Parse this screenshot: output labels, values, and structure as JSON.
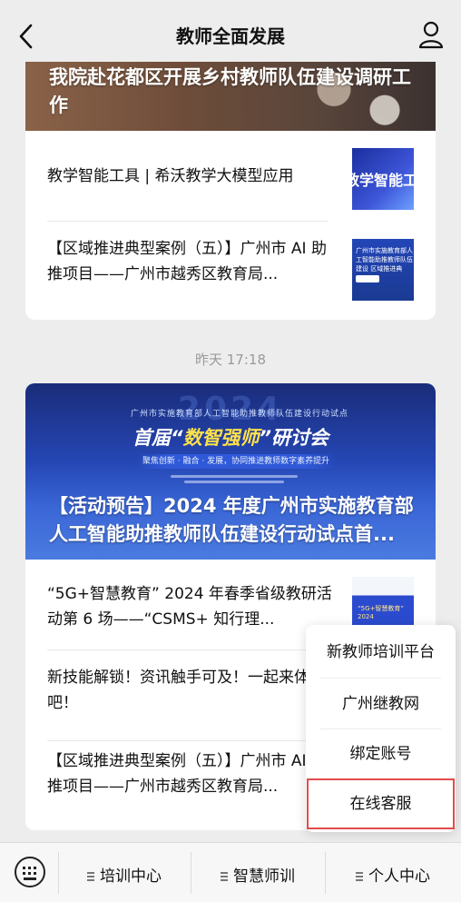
{
  "header": {
    "title": "教师全面发展",
    "back_icon": "chevron-left-icon",
    "profile_icon": "user-icon"
  },
  "card1": {
    "banner_title": "我院赴花都区开展乡村教师队伍建设调研工作",
    "items": [
      {
        "title": "教学智能工具 | 希沃教学大模型应用",
        "thumb_text": "教学智能工"
      },
      {
        "title": "【区域推进典型案例（五）】广州市 AI 助推项目——广州市越秀区教育局...",
        "thumb_text": "广州市实施教育部人工智能助推教师队伍建设 区域推进典"
      }
    ]
  },
  "date_label": "昨天 17:18",
  "card2": {
    "banner": {
      "year": "2024",
      "header_small": "广州市实施教育部人工智能助推教师队伍建设行动试点",
      "headline_prefix": "首届“",
      "headline_highlight": "数智强师",
      "headline_suffix": "”研讨会",
      "ribbon": "聚焦创新 · 融合 · 发展，协同推进教师数字素养提升",
      "title": "【活动预告】2024 年度广州市实施教育部人工智能助推教师队伍建设行动试点首..."
    },
    "items": [
      {
        "title": "“5G+智慧教育” 2024 年春季省级教研活动第 6 场——“CSMS+ 知行理...",
        "thumb_text": "“5G+智慧教育” 2024"
      },
      {
        "title": "新技能解锁！资讯触手可及！一起来体验吧！"
      },
      {
        "title": "【区域推进典型案例（五）】广州市 AI 助推项目——广州市越秀区教育局..."
      }
    ]
  },
  "popup_menu": {
    "items": [
      {
        "label": "新教师培训平台"
      },
      {
        "label": "广州继教网"
      },
      {
        "label": "绑定账号"
      },
      {
        "label": "在线客服",
        "highlighted": true
      }
    ],
    "highlight_color": "#e24b4b"
  },
  "tabbar": {
    "keyboard_icon": "keyboard-icon",
    "tabs": [
      {
        "label": "培训中心"
      },
      {
        "label": "智慧师训"
      },
      {
        "label": "个人中心"
      }
    ]
  }
}
